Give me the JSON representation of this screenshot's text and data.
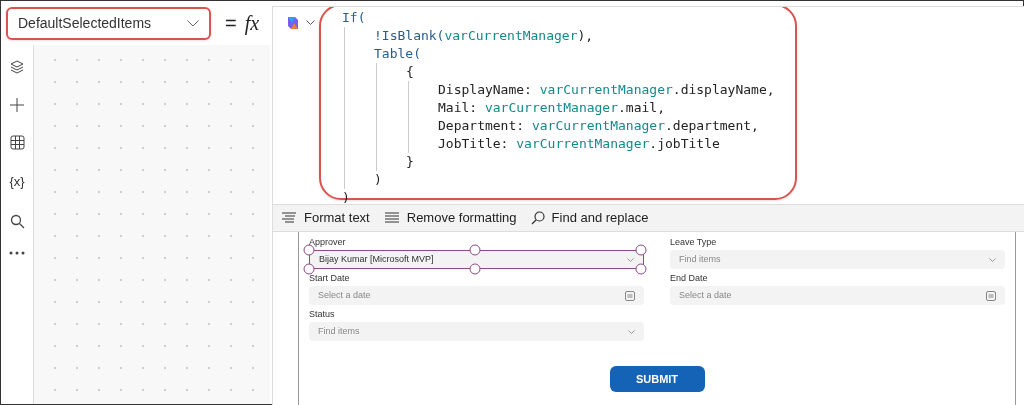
{
  "property_selector": {
    "value": "DefaultSelectedItems"
  },
  "formula_bar": {
    "equals": "=",
    "fx": "fx"
  },
  "left_rail": {
    "variables_label": "{x}"
  },
  "code": [
    {
      "tokens": [
        {
          "text": "If(",
          "kind": "function"
        }
      ],
      "children": [
        {
          "tokens": [
            {
              "text": "!IsBlank(",
              "kind": "function"
            },
            {
              "text": "varCurrentManager",
              "kind": "variable"
            },
            {
              "text": "),",
              "kind": "plain"
            }
          ]
        },
        {
          "tokens": [
            {
              "text": "Table(",
              "kind": "function"
            }
          ],
          "children": [
            {
              "tokens": [
                {
                  "text": "{",
                  "kind": "plain"
                }
              ],
              "children": [
                {
                  "tokens": [
                    {
                      "text": "DisplayName: ",
                      "kind": "plain"
                    },
                    {
                      "text": "varCurrentManager",
                      "kind": "variable"
                    },
                    {
                      "text": ".displayName,",
                      "kind": "plain"
                    }
                  ]
                },
                {
                  "tokens": [
                    {
                      "text": "Mail: ",
                      "kind": "plain"
                    },
                    {
                      "text": "varCurrentManager",
                      "kind": "variable"
                    },
                    {
                      "text": ".mail,",
                      "kind": "plain"
                    }
                  ]
                },
                {
                  "tokens": [
                    {
                      "text": "Department: ",
                      "kind": "plain"
                    },
                    {
                      "text": "varCurrentManager",
                      "kind": "variable"
                    },
                    {
                      "text": ".department,",
                      "kind": "plain"
                    }
                  ]
                },
                {
                  "tokens": [
                    {
                      "text": "JobTitle: ",
                      "kind": "plain"
                    },
                    {
                      "text": "varCurrentManager",
                      "kind": "variable"
                    },
                    {
                      "text": ".jobTitle",
                      "kind": "plain"
                    }
                  ]
                }
              ]
            },
            {
              "tokens": [
                {
                  "text": "}",
                  "kind": "plain"
                }
              ]
            }
          ]
        },
        {
          "tokens": [
            {
              "text": ")",
              "kind": "plain"
            }
          ]
        }
      ]
    },
    {
      "tokens": [
        {
          "text": ")",
          "kind": "plain"
        }
      ]
    }
  ],
  "toolbar": [
    "Format text",
    "Remove formatting",
    "Find and replace"
  ],
  "form_fields": [
    {
      "label": "Approver",
      "kind": "dropdown",
      "value": "Bijay Kumar [Microsoft MVP]",
      "selected": true
    },
    {
      "label": "Leave Type",
      "kind": "dropdown",
      "placeholder": "Find items",
      "selected": false
    },
    {
      "label": "Start Date",
      "kind": "date",
      "placeholder": "Select a date",
      "selected": false
    },
    {
      "label": "End Date",
      "kind": "date",
      "placeholder": "Select a date",
      "selected": false
    },
    {
      "label": "Status",
      "kind": "dropdown",
      "placeholder": "Find items",
      "selected": false
    }
  ],
  "submit_button": {
    "label": "SUBMIT"
  }
}
